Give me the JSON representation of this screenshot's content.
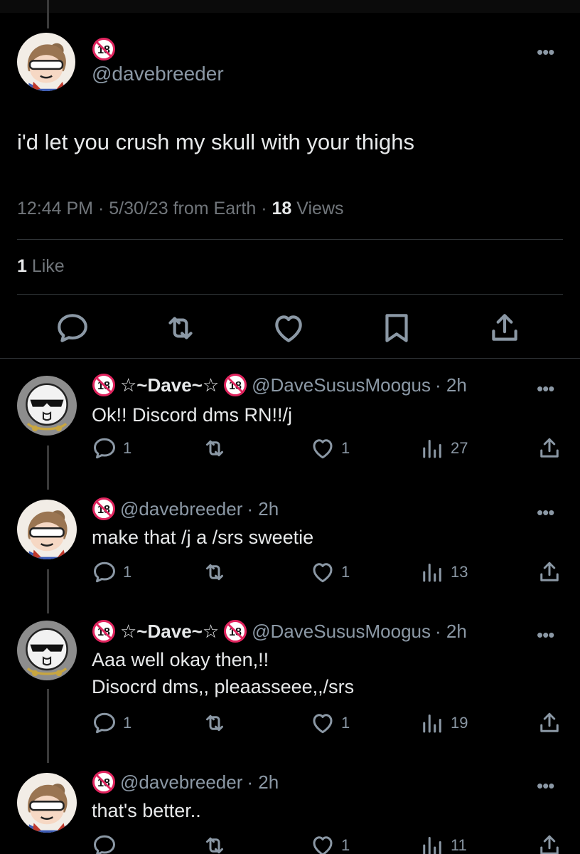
{
  "main_tweet": {
    "handle": "@davebreeder",
    "text": "i'd let you crush my skull with your thighs",
    "time": "12:44 PM · 5/30/23 from Earth · ",
    "views_count": "18",
    "views_label": " Views",
    "likes_count": "1",
    "likes_label": " Like"
  },
  "replies": [
    {
      "name": "☆~Dave~☆",
      "handle": "@DaveSususMoogus",
      "age": "· 2h",
      "lines": [
        "Ok!! Discord dms RN!!/j"
      ],
      "replies": "1",
      "likes": "1",
      "views": "27"
    },
    {
      "name": "",
      "handle": "@davebreeder",
      "age": "· 2h",
      "lines": [
        "make that /j a /srs sweetie"
      ],
      "replies": "1",
      "likes": "1",
      "views": "13"
    },
    {
      "name": "☆~Dave~☆",
      "handle": "@DaveSususMoogus",
      "age": "· 2h",
      "lines": [
        "Aaa well okay then,!!",
        "Disocrd dms,, pleaasseee,,/srs"
      ],
      "replies": "1",
      "likes": "1",
      "views": "19"
    },
    {
      "name": "",
      "handle": "@davebreeder",
      "age": "· 2h",
      "lines": [
        "that's better.."
      ],
      "replies": "",
      "likes": "1",
      "views": "11"
    }
  ],
  "icons": {
    "more": "more-icon",
    "reply": "reply-icon",
    "retweet": "retweet-icon",
    "like": "heart-icon",
    "bookmark": "bookmark-icon",
    "share": "share-icon",
    "views": "views-icon",
    "badge": "18-plus-badge-icon"
  },
  "colors": {
    "background": "#000000",
    "text": "#e7e9ea",
    "muted": "#8b98a5",
    "badge_red": "#e0245e"
  }
}
